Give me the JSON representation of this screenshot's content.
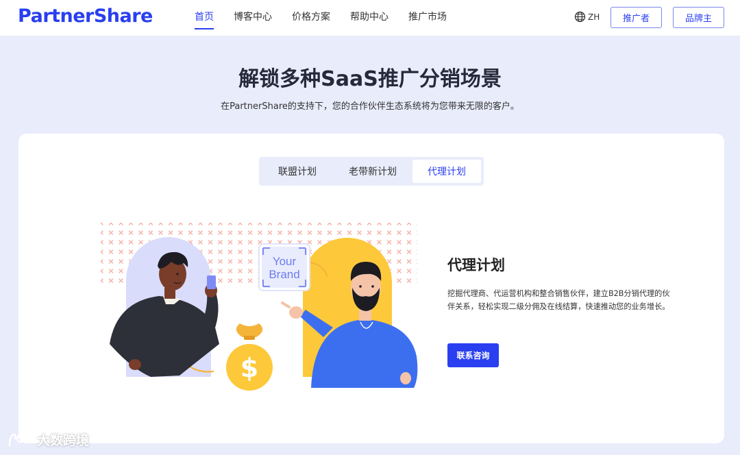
{
  "header": {
    "logo": "PartnerShare",
    "nav": [
      "首页",
      "博客中心",
      "价格方案",
      "帮助中心",
      "推广市场"
    ],
    "active_nav": "首页",
    "lang": "ZH",
    "promoter_button": "推广者",
    "brand_button": "品牌主"
  },
  "hero": {
    "title": "解锁多种SaaS推广分销场景",
    "subtitle": "在PartnerShare的支持下，您的合作伙伴生态系统将为您带来无限的客户。"
  },
  "tabs": [
    "联盟计划",
    "老带新计划",
    "代理计划"
  ],
  "active_tab": "代理计划",
  "illustration": {
    "brand_card_line1": "Your",
    "brand_card_line2": "Brand"
  },
  "plan": {
    "title": "代理计划",
    "description": "挖掘代理商、代运营机构和整合销售伙伴，建立B2B分销代理的伙伴关系，轻松实现二级分佣及在线结算，快速推动您的业务增长。",
    "button": "联系咨询"
  },
  "watermark": "大数跨境",
  "colors": {
    "accent": "#2a3ff0",
    "background": "#e9ecfb",
    "yellow": "#fdc93a",
    "person_blue": "#3c6ff0"
  },
  "icons": [
    "globe-icon",
    "dollar-bag-icon",
    "phone-icon"
  ]
}
